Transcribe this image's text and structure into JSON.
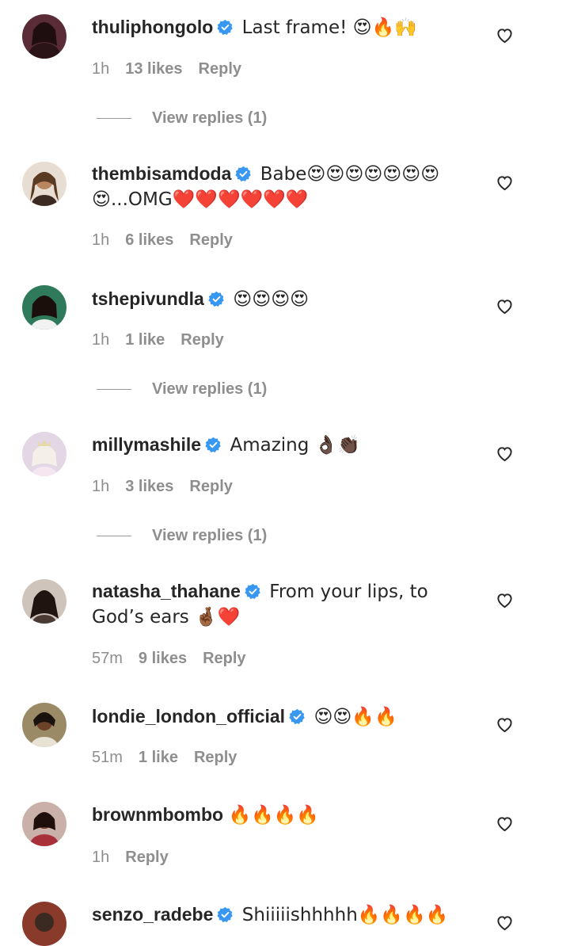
{
  "comments": [
    {
      "username": "thuliphongolo",
      "text": "Last frame! 😍🔥🙌",
      "time": "1h",
      "likes": "13 likes",
      "reply": "Reply",
      "view_replies": "View replies (1)",
      "avatar_color": "#5a2c37"
    },
    {
      "username": "thembisamdoda",
      "text": "Babe😍😍😍😍😍😍😍😍...OMG❤️❤️❤️❤️❤️❤️",
      "time": "1h",
      "likes": "6 likes",
      "reply": "Reply",
      "avatar_color": "#c9a27e"
    },
    {
      "username": "tshepivundla",
      "text": "😍😍😍😍",
      "time": "1h",
      "likes": "1 like",
      "reply": "Reply",
      "view_replies": "View replies (1)",
      "avatar_color": "#2e7a5a"
    },
    {
      "username": "millymashile",
      "text": "Amazing 👌🏿👏🏿",
      "time": "1h",
      "likes": "3 likes",
      "reply": "Reply",
      "view_replies": "View replies (1)",
      "avatar_color": "#e3d7e6"
    },
    {
      "username": "natasha_thahane",
      "text": "From your lips, to God’s ears 🤞🏾❤️",
      "time": "57m",
      "likes": "9 likes",
      "reply": "Reply",
      "avatar_color": "#4b3a34"
    },
    {
      "username": "londie_london_official",
      "text": "😍😍🔥🔥",
      "time": "51m",
      "likes": "1 like",
      "reply": "Reply",
      "avatar_color": "#6b5a3a"
    },
    {
      "username": "brownmbombo",
      "text": "🔥🔥🔥🔥",
      "time": "1h",
      "reply": "Reply",
      "avatar_color": "#7a2f35"
    },
    {
      "username": "senzo_radebe",
      "text": "Shiiiiishhhhh🔥🔥🔥🔥",
      "avatar_color": "#3b2a22"
    }
  ],
  "colors": {
    "verified_blue": "#3897f0",
    "meta_gray": "#8e8e8e",
    "text": "#262626"
  },
  "icons": {
    "verified": "verified-badge-icon",
    "heart": "heart-outline-icon"
  }
}
